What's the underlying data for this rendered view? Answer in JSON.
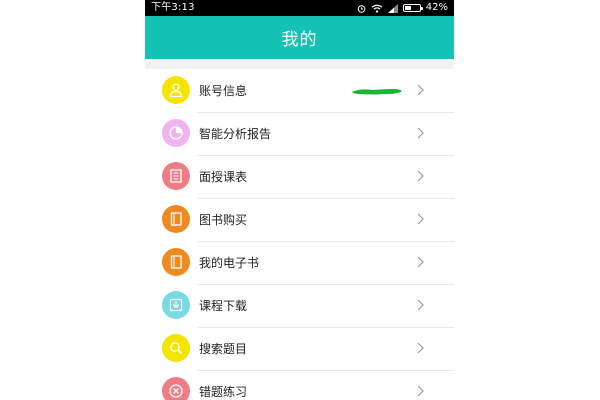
{
  "status_bar": {
    "time": "下午3:13",
    "battery_text": "42%",
    "battery_level": 0.42
  },
  "header": {
    "title": "我的"
  },
  "menu": {
    "items": [
      {
        "label": "账号信息",
        "icon": "user-icon",
        "color": "#f5e300"
      },
      {
        "label": "智能分析报告",
        "icon": "pie-chart-icon",
        "color": "#f1b3f0"
      },
      {
        "label": "面授课表",
        "icon": "schedule-icon",
        "color": "#f07d86"
      },
      {
        "label": "图书购买",
        "icon": "book-icon",
        "color": "#f08a1e"
      },
      {
        "label": "我的电子书",
        "icon": "ebook-icon",
        "color": "#f08a1e"
      },
      {
        "label": "课程下载",
        "icon": "download-icon",
        "color": "#79d9e7"
      },
      {
        "label": "搜索题目",
        "icon": "search-icon",
        "color": "#f5e300"
      },
      {
        "label": "错题练习",
        "icon": "cross-icon",
        "color": "#f07d86"
      }
    ]
  },
  "colors": {
    "header": "#14c3b5",
    "redaction": "#1bb534"
  }
}
